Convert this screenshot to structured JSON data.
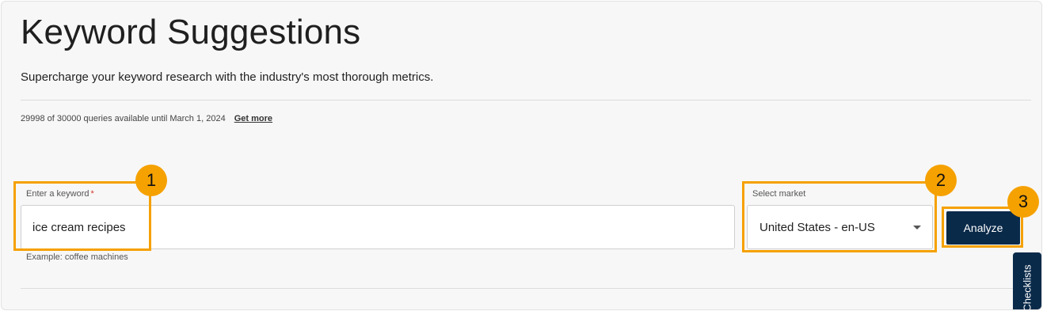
{
  "header": {
    "title": "Keyword Suggestions",
    "subtitle": "Supercharge your keyword research with the industry's most thorough metrics."
  },
  "quota": {
    "text": "29998 of 30000 queries available until March 1, 2024",
    "get_more_label": "Get more"
  },
  "keyword_field": {
    "label": "Enter a keyword",
    "required_mark": "*",
    "value": "ice cream recipes",
    "helper": "Example: coffee machines"
  },
  "market_field": {
    "label": "Select market",
    "selected": "United States - en-US"
  },
  "analyze_label": "Analyze",
  "annotations": [
    "1",
    "2",
    "3"
  ],
  "side_tab_label": "Checklists",
  "colors": {
    "highlight": "#f5a100",
    "primary_button": "#0a2a4a"
  }
}
